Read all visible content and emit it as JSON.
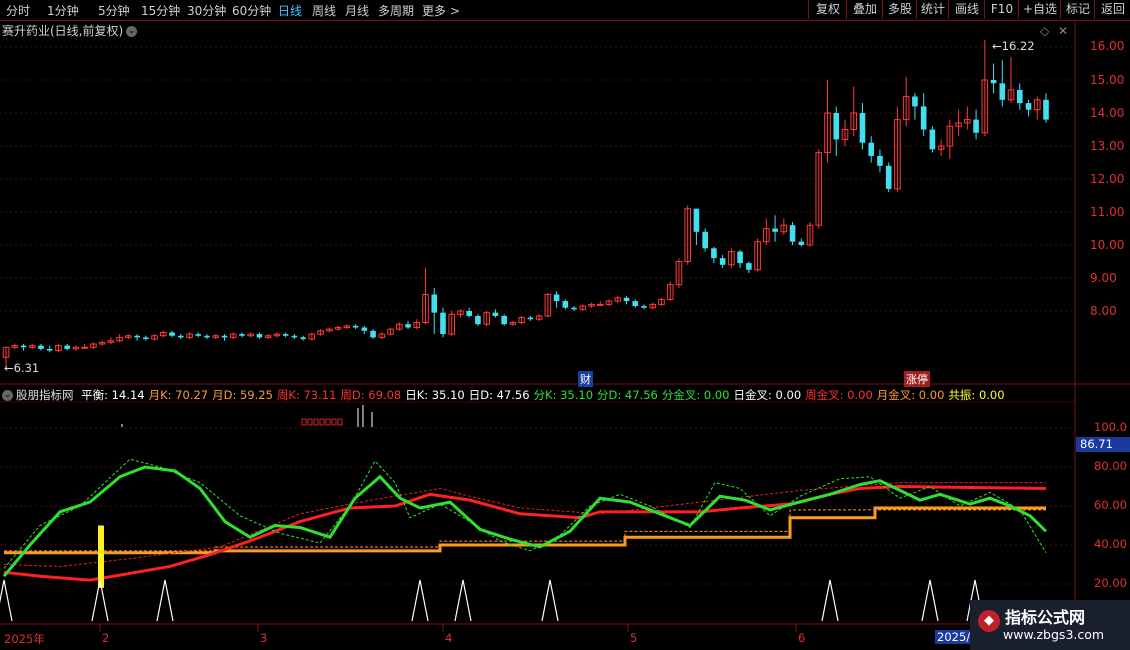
{
  "toolbar": {
    "periods": [
      "分时",
      "1分钟",
      "5分钟",
      "15分钟",
      "30分钟",
      "60分钟",
      "日线",
      "周线",
      "月线",
      "多周期",
      "更多 >"
    ],
    "active_period": "日线",
    "right_buttons": [
      "复权",
      "叠加",
      "多股",
      "统计",
      "画线",
      "F10",
      "+自选",
      "返回"
    ]
  },
  "main_chart": {
    "title": "赛升药业(日线,前复权)",
    "high_label": "16.22",
    "low_label": "6.31",
    "events": [
      "财",
      "涨停"
    ],
    "y_ticks": [
      "16.00",
      "15.00",
      "14.00",
      "13.00",
      "12.00",
      "11.00",
      "10.00",
      "9.00",
      "8.00"
    ]
  },
  "indicator": {
    "name": "股朋指标网",
    "values": [
      {
        "label": "平衡",
        "value": "14.14",
        "color": "#ffffff"
      },
      {
        "label": "月K",
        "value": "70.27",
        "color": "#ff9a3c"
      },
      {
        "label": "月D",
        "value": "59.25",
        "color": "#ff9a3c"
      },
      {
        "label": "周K",
        "value": "73.11",
        "color": "#ff3030"
      },
      {
        "label": "周D",
        "value": "69.08",
        "color": "#ff3030"
      },
      {
        "label": "日K",
        "value": "35.10",
        "color": "#ffffff"
      },
      {
        "label": "日D",
        "value": "47.56",
        "color": "#ffffff"
      },
      {
        "label": "分K",
        "value": "35.10",
        "color": "#30e030"
      },
      {
        "label": "分D",
        "value": "47.56",
        "color": "#30e030"
      },
      {
        "label": "分金叉",
        "value": "0.00",
        "color": "#30e030"
      },
      {
        "label": "日金叉",
        "value": "0.00",
        "color": "#ffffff"
      },
      {
        "label": "周金叉",
        "value": "0.00",
        "color": "#ff3030"
      },
      {
        "label": "月金叉",
        "value": "0.00",
        "color": "#ff9a3c"
      },
      {
        "label": "共振",
        "value": "0.00",
        "color": "#ffff40"
      }
    ],
    "current_value": "86.71",
    "y_ticks": [
      "100.0",
      "80.00",
      "60.00",
      "40.00",
      "20.00"
    ]
  },
  "x_axis": {
    "labels": [
      "2025年",
      "2",
      "3",
      "4",
      "5",
      "6"
    ],
    "cursor_date": "2025/0"
  },
  "watermark": {
    "line1": "指标公式网",
    "line2": "www.zbgs3.com"
  },
  "chart_data": {
    "type": "candlestick",
    "title": "赛升药业(日线,前复权)",
    "ylim": [
      6.0,
      16.6
    ],
    "high": 16.22,
    "low": 6.31,
    "candles": [
      [
        6.6,
        6.9,
        6.9,
        6.3
      ],
      [
        6.9,
        6.95,
        7.0,
        6.85
      ],
      [
        6.95,
        6.9,
        7.0,
        6.8
      ],
      [
        6.9,
        6.95,
        7.0,
        6.85
      ],
      [
        6.95,
        6.85,
        7.0,
        6.8
      ],
      [
        6.85,
        6.8,
        6.95,
        6.75
      ],
      [
        6.8,
        6.95,
        7.0,
        6.75
      ],
      [
        6.95,
        6.85,
        7.0,
        6.8
      ],
      [
        6.85,
        6.9,
        6.95,
        6.8
      ],
      [
        6.9,
        6.9,
        7.0,
        6.85
      ],
      [
        6.9,
        7.0,
        7.05,
        6.85
      ],
      [
        7.0,
        7.05,
        7.1,
        6.95
      ],
      [
        7.05,
        7.1,
        7.2,
        7.0
      ],
      [
        7.1,
        7.2,
        7.3,
        7.05
      ],
      [
        7.2,
        7.25,
        7.3,
        7.15
      ],
      [
        7.25,
        7.2,
        7.3,
        7.1
      ],
      [
        7.2,
        7.15,
        7.25,
        7.1
      ],
      [
        7.15,
        7.25,
        7.3,
        7.1
      ],
      [
        7.25,
        7.35,
        7.4,
        7.2
      ],
      [
        7.35,
        7.25,
        7.4,
        7.2
      ],
      [
        7.25,
        7.2,
        7.3,
        7.15
      ],
      [
        7.2,
        7.3,
        7.35,
        7.15
      ],
      [
        7.3,
        7.25,
        7.35,
        7.2
      ],
      [
        7.25,
        7.2,
        7.3,
        7.15
      ],
      [
        7.2,
        7.25,
        7.3,
        7.15
      ],
      [
        7.25,
        7.2,
        7.3,
        7.1
      ],
      [
        7.2,
        7.3,
        7.35,
        7.15
      ],
      [
        7.3,
        7.25,
        7.35,
        7.2
      ],
      [
        7.25,
        7.3,
        7.35,
        7.2
      ],
      [
        7.3,
        7.2,
        7.35,
        7.15
      ],
      [
        7.2,
        7.25,
        7.3,
        7.15
      ],
      [
        7.25,
        7.3,
        7.35,
        7.2
      ],
      [
        7.3,
        7.25,
        7.35,
        7.2
      ],
      [
        7.25,
        7.2,
        7.3,
        7.15
      ],
      [
        7.2,
        7.15,
        7.25,
        7.1
      ],
      [
        7.15,
        7.3,
        7.35,
        7.1
      ],
      [
        7.3,
        7.4,
        7.45,
        7.25
      ],
      [
        7.4,
        7.45,
        7.5,
        7.35
      ],
      [
        7.45,
        7.5,
        7.55,
        7.4
      ],
      [
        7.5,
        7.55,
        7.6,
        7.45
      ],
      [
        7.55,
        7.5,
        7.6,
        7.45
      ],
      [
        7.5,
        7.4,
        7.55,
        7.3
      ],
      [
        7.4,
        7.2,
        7.45,
        7.15
      ],
      [
        7.2,
        7.3,
        7.35,
        7.15
      ],
      [
        7.3,
        7.45,
        7.5,
        7.25
      ],
      [
        7.45,
        7.6,
        7.65,
        7.4
      ],
      [
        7.6,
        7.5,
        7.7,
        7.45
      ],
      [
        7.5,
        7.65,
        7.75,
        7.45
      ],
      [
        7.65,
        8.5,
        9.3,
        7.6
      ],
      [
        8.5,
        7.95,
        8.7,
        7.3
      ],
      [
        7.95,
        7.3,
        8.1,
        7.2
      ],
      [
        7.3,
        7.9,
        8.0,
        7.25
      ],
      [
        7.9,
        8.0,
        8.05,
        7.8
      ],
      [
        8.0,
        7.85,
        8.1,
        7.8
      ],
      [
        7.85,
        7.6,
        7.9,
        7.55
      ],
      [
        7.6,
        7.95,
        8.0,
        7.55
      ],
      [
        7.95,
        7.85,
        8.05,
        7.8
      ],
      [
        7.85,
        7.6,
        7.9,
        7.55
      ],
      [
        7.6,
        7.65,
        7.7,
        7.55
      ],
      [
        7.65,
        7.8,
        7.85,
        7.6
      ],
      [
        7.8,
        7.75,
        7.85,
        7.7
      ],
      [
        7.75,
        7.85,
        7.9,
        7.7
      ],
      [
        7.85,
        8.5,
        8.55,
        7.8
      ],
      [
        8.5,
        8.3,
        8.6,
        8.1
      ],
      [
        8.3,
        8.1,
        8.35,
        8.05
      ],
      [
        8.1,
        8.05,
        8.15,
        8.0
      ],
      [
        8.05,
        8.15,
        8.2,
        8.0
      ],
      [
        8.15,
        8.2,
        8.25,
        8.1
      ],
      [
        8.2,
        8.2,
        8.3,
        8.15
      ],
      [
        8.2,
        8.3,
        8.35,
        8.15
      ],
      [
        8.3,
        8.4,
        8.45,
        8.25
      ],
      [
        8.4,
        8.3,
        8.45,
        8.2
      ],
      [
        8.3,
        8.15,
        8.35,
        8.1
      ],
      [
        8.15,
        8.1,
        8.2,
        8.05
      ],
      [
        8.1,
        8.2,
        8.25,
        8.05
      ],
      [
        8.2,
        8.35,
        8.4,
        8.15
      ],
      [
        8.35,
        8.8,
        8.9,
        8.3
      ],
      [
        8.8,
        9.5,
        9.6,
        8.7
      ],
      [
        9.5,
        11.1,
        11.2,
        9.4
      ],
      [
        11.1,
        10.4,
        11.1,
        10.0
      ],
      [
        10.4,
        9.9,
        10.5,
        9.8
      ],
      [
        9.9,
        9.6,
        9.95,
        9.45
      ],
      [
        9.6,
        9.4,
        9.7,
        9.3
      ],
      [
        9.4,
        9.8,
        9.9,
        9.3
      ],
      [
        9.8,
        9.45,
        9.85,
        9.3
      ],
      [
        9.45,
        9.25,
        9.5,
        9.15
      ],
      [
        9.25,
        10.1,
        10.2,
        9.2
      ],
      [
        10.1,
        10.5,
        10.8,
        10.0
      ],
      [
        10.5,
        10.4,
        10.9,
        10.1
      ],
      [
        10.4,
        10.6,
        10.8,
        10.3
      ],
      [
        10.6,
        10.1,
        10.7,
        10.0
      ],
      [
        10.1,
        10.0,
        10.2,
        9.95
      ],
      [
        10.0,
        10.6,
        10.7,
        9.95
      ],
      [
        10.6,
        12.8,
        12.9,
        10.5
      ],
      [
        12.8,
        14.0,
        15.0,
        12.5
      ],
      [
        14.0,
        13.2,
        14.2,
        12.7
      ],
      [
        13.2,
        13.5,
        13.8,
        13.0
      ],
      [
        13.5,
        14.0,
        14.8,
        13.3
      ],
      [
        14.0,
        13.1,
        14.3,
        12.9
      ],
      [
        13.1,
        12.7,
        13.3,
        12.5
      ],
      [
        12.7,
        12.4,
        12.9,
        12.2
      ],
      [
        12.4,
        11.7,
        12.5,
        11.6
      ],
      [
        11.7,
        13.8,
        14.2,
        11.6
      ],
      [
        13.8,
        14.5,
        15.1,
        13.6
      ],
      [
        14.5,
        14.2,
        14.6,
        13.8
      ],
      [
        14.2,
        13.5,
        14.6,
        13.3
      ],
      [
        13.5,
        12.9,
        13.6,
        12.8
      ],
      [
        12.9,
        13.0,
        13.2,
        12.7
      ],
      [
        13.0,
        13.6,
        13.8,
        12.6
      ],
      [
        13.6,
        13.7,
        14.1,
        13.3
      ],
      [
        13.7,
        13.8,
        14.2,
        13.5
      ],
      [
        13.8,
        13.4,
        14.1,
        13.2
      ],
      [
        13.4,
        15.0,
        16.22,
        13.3
      ],
      [
        15.0,
        14.9,
        15.5,
        14.6
      ],
      [
        14.9,
        14.4,
        15.6,
        14.2
      ],
      [
        14.4,
        14.7,
        15.7,
        14.3
      ],
      [
        14.7,
        14.3,
        14.9,
        14.1
      ],
      [
        14.3,
        14.1,
        14.4,
        13.9
      ],
      [
        14.1,
        14.4,
        14.5,
        13.8
      ],
      [
        14.4,
        13.8,
        14.6,
        13.7
      ]
    ]
  }
}
